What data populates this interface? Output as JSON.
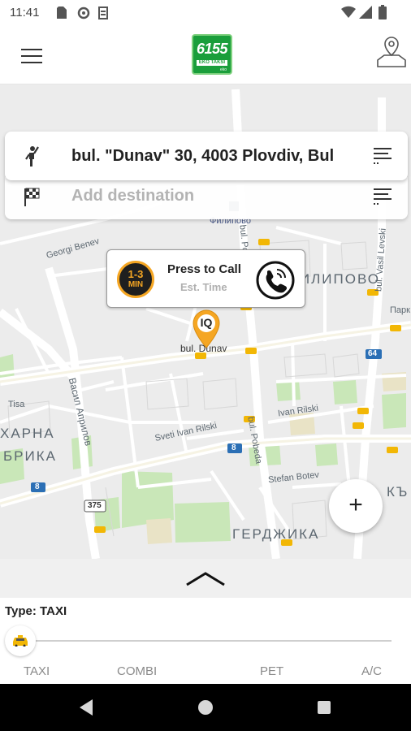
{
  "status_bar": {
    "time": "11:41",
    "icons": [
      "sd-card-icon",
      "settings-icon",
      "s-icon",
      "wifi-icon",
      "signal-icon",
      "battery-icon"
    ]
  },
  "header": {
    "logo_number": "6155",
    "logo_subtitle": "EKO TAKSI",
    "logo_tagline": "eko",
    "menu_icon": "hamburger-menu-icon",
    "map_icon": "map-pin-icon",
    "brand_color": "#1a9e3b"
  },
  "address": {
    "pickup": "bul. \"Dunav\" 30, 4003 Plovdiv, Bul",
    "destination_placeholder": "Add destination",
    "destination_value": ""
  },
  "call_bubble": {
    "eta_value": "1-3",
    "eta_unit": "MIN",
    "title": "Press to Call",
    "subtitle": "Est. Time",
    "accent_color": "#f5a623"
  },
  "map": {
    "labels": {
      "filipovo": "Филипово",
      "georgi_benev": "Georgi Benev",
      "bul_dunav": "bul. Dunav",
      "bul_pobeda_top": "bul. Pobeda",
      "bul_pobeda_bottom": "bul. Pobeda",
      "filipovo_district": "ФИЛИПОВО",
      "vasil_levski": "bul. Vasil Levski",
      "vasil_aprilov": "Васил Априлов",
      "tisa": "Tisa",
      "harna": "ХАРНА",
      "brika": "БРИКА",
      "sveti_ivan_rilski": "Sveti Ivan Rilski",
      "ivan_rilski": "Ivan Rilski",
      "stefan_botev": "Stefan Botev",
      "gerdzhika": "ГЕРДЖИКА",
      "park": "Парк",
      "route_8a": "8",
      "route_8b": "8",
      "route_375": "375",
      "route_64": "64",
      "kamenitsa": "КЪ"
    },
    "pin_label": "IQ",
    "zoom_button": "+"
  },
  "panel": {
    "type_label": "Type: TAXI",
    "options": [
      "TAXI",
      "COMBI",
      "PET",
      "A/C"
    ],
    "selected": "TAXI",
    "handle_icon": "chevron-up-icon"
  },
  "nav_bar": {
    "back": "back-icon",
    "home": "home-icon",
    "recents": "recents-icon"
  }
}
